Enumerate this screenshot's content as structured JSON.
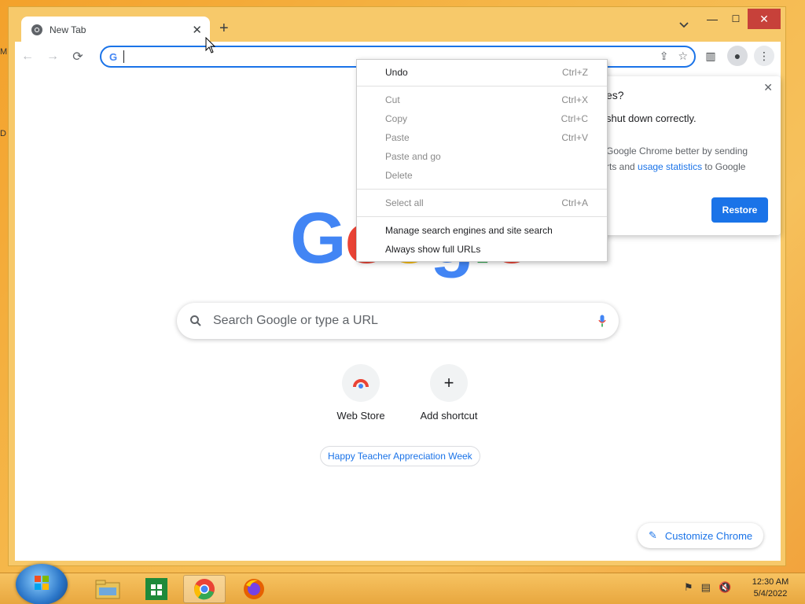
{
  "desktop": {
    "edge_label_top": "M",
    "edge_label_mid": "D"
  },
  "tab": {
    "title": "New Tab",
    "close": "✕"
  },
  "new_tab_button": "+",
  "window_controls": {
    "minimize": "—",
    "maximize": "☐",
    "close": "✕"
  },
  "omnibox": {
    "search_engine_letter": "G"
  },
  "logo": [
    "G",
    "o",
    "o",
    "g",
    "l",
    "e"
  ],
  "search": {
    "placeholder": "Search Google or type a URL"
  },
  "shortcuts": [
    {
      "label": "Web Store"
    },
    {
      "label": "Add shortcut",
      "symbol": "+"
    }
  ],
  "doodle_chip": "Happy Teacher Appreciation Week",
  "customize_button": "Customize Chrome",
  "restore_dialog": {
    "title_fragment": "es?",
    "message_fragment": "shut down correctly.",
    "line1_fragment": "Google Chrome better by sending",
    "line2_prefix": "rts and ",
    "line2_link": "usage statistics",
    "line2_suffix": " to Google",
    "button": "Restore",
    "close": "✕"
  },
  "context_menu": {
    "items": [
      {
        "label": "Undo",
        "shortcut": "Ctrl+Z",
        "enabled": true
      },
      {
        "label": "Cut",
        "shortcut": "Ctrl+X",
        "enabled": false
      },
      {
        "label": "Copy",
        "shortcut": "Ctrl+C",
        "enabled": false
      },
      {
        "label": "Paste",
        "shortcut": "Ctrl+V",
        "enabled": false
      },
      {
        "label": "Paste and go",
        "shortcut": "",
        "enabled": false
      },
      {
        "label": "Delete",
        "shortcut": "",
        "enabled": false
      },
      {
        "label": "Select all",
        "shortcut": "Ctrl+A",
        "enabled": false
      },
      {
        "label": "Manage search engines and site search",
        "shortcut": "",
        "enabled": true
      },
      {
        "label": "Always show full URLs",
        "shortcut": "",
        "enabled": true
      }
    ]
  },
  "taskbar": {
    "apps": [
      "file-explorer-icon",
      "store-icon",
      "chrome-icon",
      "firefox-icon"
    ],
    "clock_time": "12:30 AM",
    "clock_date": "5/4/2022"
  },
  "colors": {
    "accent": "#1a73e8",
    "window_frame": "#f7c96a",
    "close_red": "#c7413a"
  }
}
